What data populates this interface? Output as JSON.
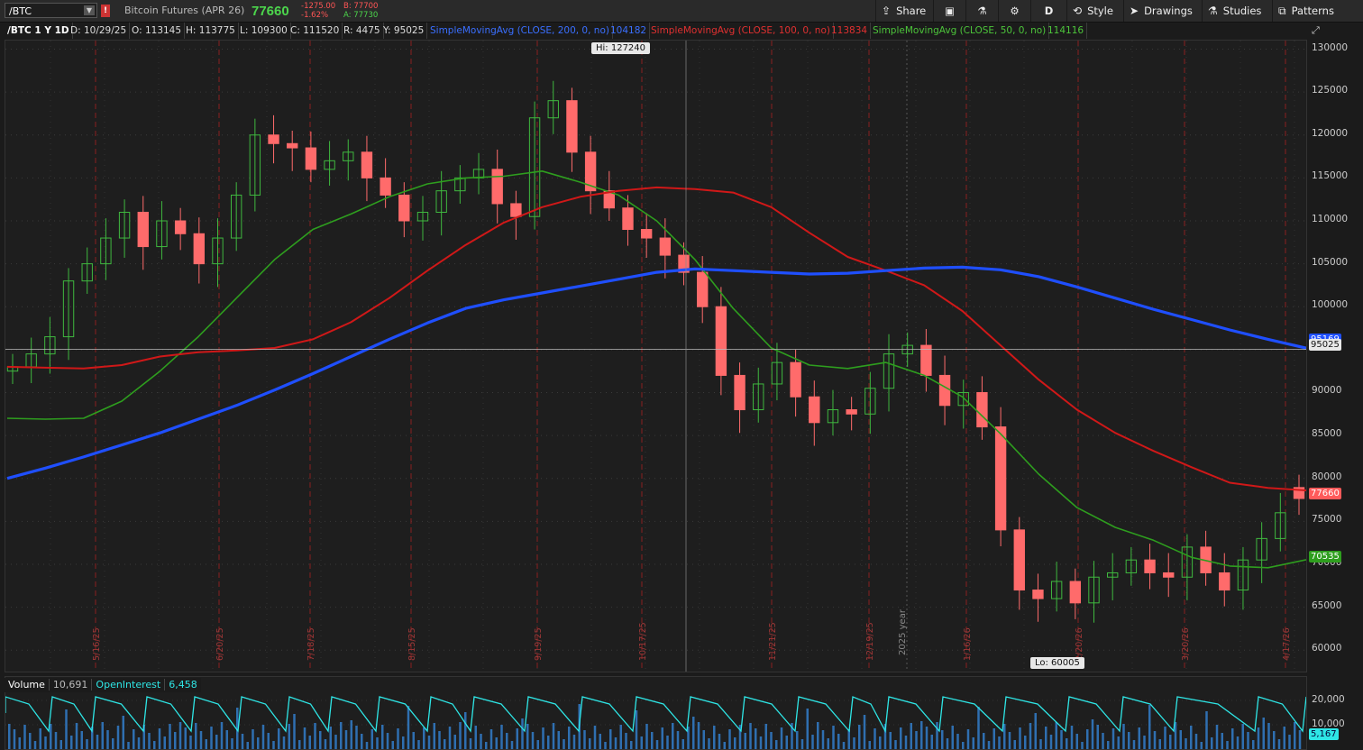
{
  "toolbar": {
    "symbol": "/BTC",
    "description": "Bitcoin Futures (APR 26)",
    "last": "77660",
    "change": "-1275.00",
    "change_pct": "-1.62%",
    "bid": "B: 77700",
    "ask": "A: 77730",
    "share": "Share",
    "period": "D",
    "style": "Style",
    "drawings": "Drawings",
    "studies": "Studies",
    "patterns": "Patterns"
  },
  "infobar": {
    "title": "/BTC 1 Y 1D",
    "date": "D: 10/29/25",
    "open": "O: 113145",
    "high": "H: 113775",
    "low": "L: 109300",
    "close": "C: 111520",
    "range": "R: 4475",
    "y": "Y: 95025",
    "sma200_label": "SimpleMovingAvg (CLOSE, 200, 0, no)",
    "sma200_val": "104182",
    "sma100_label": "SimpleMovingAvg (CLOSE, 100, 0, no)",
    "sma100_val": "113834",
    "sma50_label": "SimpleMovingAvg (CLOSE, 50, 0, no)",
    "sma50_val": "114116"
  },
  "annotations": {
    "high_callout": "Hi: 127240",
    "low_callout": "Lo: 60005",
    "crosshair_price": "95025",
    "sma200_tag": "95169",
    "last_tag": "77660",
    "sma50_tag": "70535",
    "year_label": "2025 year"
  },
  "date_labels": [
    "5/16/25",
    "6/20/25",
    "7/18/25",
    "8/15/25",
    "9/19/25",
    "10/17/25",
    "11/21/25",
    "12/19/25",
    "1/16/26",
    "2/20/26",
    "3/20/26",
    "4/17/26"
  ],
  "volume_pane": {
    "volume_label": "Volume",
    "volume_value": "10,691",
    "oi_label": "OpenInterest",
    "oi_value": "6,458",
    "oi_tag": "5,167",
    "ticks": [
      "20,000",
      "10,000"
    ]
  },
  "colors": {
    "up": "#3fb83f",
    "down": "#ff6b6b",
    "sma200": "#1f4fff",
    "sma100": "#d01818",
    "sma50": "#2e9e1e",
    "volume": "#2f6fb0",
    "open_interest": "#2ee6e6"
  },
  "chart_data": {
    "type": "candlestick",
    "y_ticks": [
      130000,
      125000,
      120000,
      115000,
      110000,
      105000,
      100000,
      95000,
      90000,
      85000,
      80000,
      75000,
      70000,
      65000,
      60000
    ],
    "ylim": [
      57500,
      131000
    ],
    "high": 127240,
    "low": 60005,
    "sma200": [
      80000,
      81200,
      82500,
      83900,
      85300,
      86900,
      88500,
      90300,
      92200,
      94200,
      96200,
      98100,
      99800,
      100800,
      101600,
      102400,
      103200,
      104000,
      104400,
      104200,
      104000,
      103800,
      103900,
      104200,
      104500,
      104600,
      104300,
      103500,
      102300,
      101000,
      99700,
      98500,
      97300,
      96200,
      95169
    ],
    "sma100": [
      93000,
      92900,
      92800,
      93200,
      94200,
      94700,
      94900,
      95200,
      96200,
      98200,
      101000,
      104200,
      107200,
      109800,
      111600,
      112800,
      113500,
      113900,
      113700,
      113300,
      111600,
      108600,
      105800,
      104200,
      102500,
      99500,
      95500,
      91500,
      88000,
      85300,
      83200,
      81300,
      79500,
      78900,
      78600
    ],
    "sma50": [
      87000,
      86900,
      87000,
      89000,
      92500,
      96500,
      101000,
      105500,
      109000,
      110800,
      112800,
      114300,
      115000,
      115200,
      115800,
      114500,
      113000,
      110000,
      105500,
      99800,
      95200,
      93200,
      92800,
      93500,
      92000,
      89500,
      85200,
      80500,
      76600,
      74300,
      72800,
      70800,
      69800,
      69600,
      70535
    ],
    "closes": [
      93000,
      94500,
      96500,
      103000,
      105000,
      108000,
      111000,
      107000,
      110000,
      108500,
      105000,
      108000,
      113000,
      120000,
      119000,
      118500,
      116000,
      117000,
      118000,
      115000,
      113000,
      110000,
      111000,
      113500,
      115000,
      116000,
      112000,
      110500,
      122000,
      124000,
      118000,
      113500,
      111500,
      109000,
      108000,
      106000,
      104000,
      100000,
      92000,
      88000,
      91000,
      93500,
      89500,
      86500,
      88000,
      87500,
      90500,
      94500,
      95500,
      92000,
      88500,
      90000,
      86000,
      74000,
      67000,
      66000,
      68000,
      65500,
      68500,
      69000,
      70500,
      69000,
      68500,
      72000,
      69000,
      67000,
      70500,
      73000,
      76000,
      77660
    ],
    "opens": [
      92500,
      93000,
      94500,
      96500,
      103000,
      105000,
      108000,
      111000,
      107000,
      110000,
      108500,
      105000,
      108000,
      113000,
      120000,
      119000,
      118500,
      116000,
      117000,
      118000,
      115000,
      113000,
      110000,
      111000,
      113500,
      115000,
      116000,
      112000,
      110500,
      122000,
      124000,
      118000,
      113500,
      111500,
      109000,
      108000,
      106000,
      104000,
      100000,
      92000,
      88000,
      91000,
      93500,
      89500,
      86500,
      88000,
      87500,
      90500,
      94500,
      95500,
      92000,
      88500,
      90000,
      86000,
      74000,
      67000,
      66000,
      68000,
      65500,
      68500,
      69000,
      70500,
      69000,
      68500,
      72000,
      69000,
      67000,
      70500,
      73000,
      78935
    ]
  }
}
